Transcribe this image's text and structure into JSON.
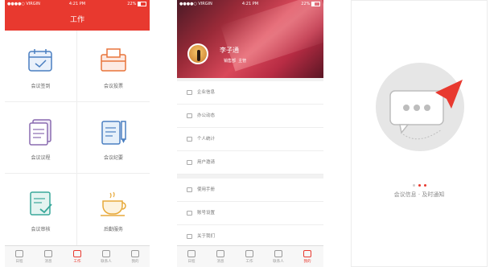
{
  "status": {
    "carrier": "●●●●○ VIRGIN",
    "time": "4:21 PM",
    "battery": "22%"
  },
  "screen1": {
    "title": "工作",
    "items": [
      {
        "label": "会议签到"
      },
      {
        "label": "会议投票"
      },
      {
        "label": "会议议程"
      },
      {
        "label": "会议纪要"
      },
      {
        "label": "会议审核"
      },
      {
        "label": "后勤服务"
      }
    ],
    "tabs": [
      {
        "label": "日程"
      },
      {
        "label": "消息"
      },
      {
        "label": "工作"
      },
      {
        "label": "联系人"
      },
      {
        "label": "我的"
      }
    ]
  },
  "screen2": {
    "user": {
      "name": "李子通",
      "dept": "销售部",
      "title": "主管"
    },
    "menu_group1": [
      {
        "label": "企业信息"
      },
      {
        "label": "办公动态"
      },
      {
        "label": "个人统计"
      },
      {
        "label": "用户邀请"
      }
    ],
    "menu_group2": [
      {
        "label": "使用手册"
      },
      {
        "label": "账号设置"
      },
      {
        "label": "关于我们"
      }
    ],
    "tabs": [
      {
        "label": "日程"
      },
      {
        "label": "消息"
      },
      {
        "label": "工作"
      },
      {
        "label": "联系人"
      },
      {
        "label": "我的"
      }
    ]
  },
  "screen3": {
    "tagline": "会议信息 · 及时通知"
  },
  "colors": {
    "accent": "#e8392f",
    "blue": "#4a7fc1",
    "orange": "#e8743b",
    "purple": "#8a6bb0",
    "teal": "#3aa89b",
    "gold": "#e7a93a"
  }
}
